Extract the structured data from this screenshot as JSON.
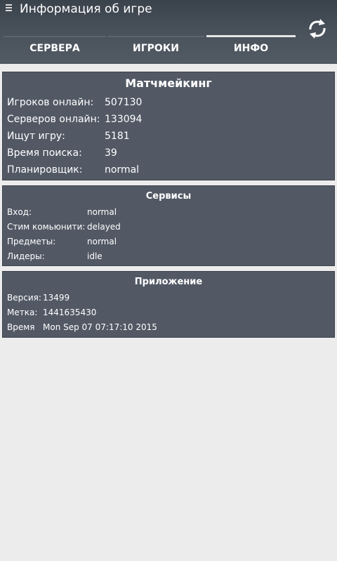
{
  "appbar": {
    "title": "Информация об игре",
    "tabs": [
      {
        "label": "СЕРВЕРА"
      },
      {
        "label": "ИГРОКИ"
      },
      {
        "label": "ИНФО"
      }
    ]
  },
  "matchmaking": {
    "title": "Матчмейкинг",
    "rows": [
      {
        "key": "Игроков онлайн:",
        "value": "507130"
      },
      {
        "key": "Серверов онлайн:",
        "value": "133094"
      },
      {
        "key": "Ищут игру:",
        "value": "5181"
      },
      {
        "key": "Время поиска:",
        "value": "39"
      },
      {
        "key": "Планировщик:",
        "value": "normal"
      }
    ]
  },
  "services": {
    "title": "Сервисы",
    "rows": [
      {
        "key": "Вход:",
        "value": "normal"
      },
      {
        "key": "Стим комьюнити:",
        "value": "delayed"
      },
      {
        "key": "Предметы:",
        "value": "normal"
      },
      {
        "key": "Лидеры:",
        "value": "idle"
      }
    ]
  },
  "app": {
    "title": "Приложение",
    "rows": [
      {
        "key": "Версия:",
        "value": "13499"
      },
      {
        "key": "Метка:",
        "value": "1441635430"
      },
      {
        "key": "Время",
        "value": "Mon Sep 07 07:17:10 2015"
      }
    ]
  },
  "colors": {
    "appbar": "#444c56",
    "card": "#525965",
    "background": "#ececec"
  }
}
